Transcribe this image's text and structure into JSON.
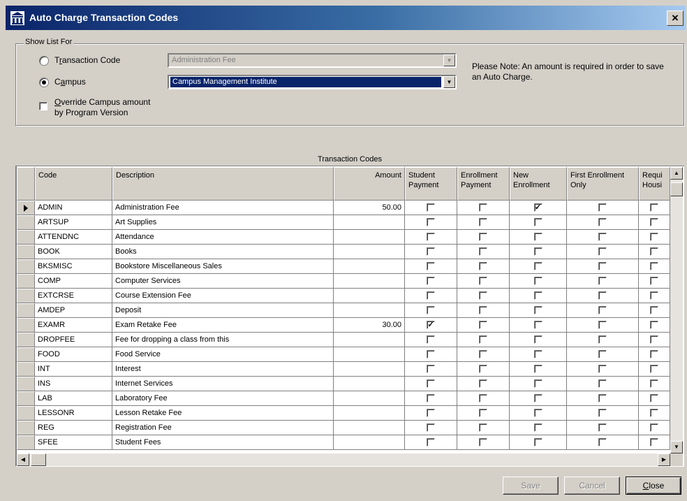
{
  "window": {
    "title": "Auto Charge Transaction Codes",
    "close_glyph": "×"
  },
  "filter": {
    "legend": "Show List For",
    "transaction_code": {
      "label": "Transaction Code",
      "accel": "r",
      "selected": false,
      "value": "Administration Fee"
    },
    "campus": {
      "label": "Campus",
      "accel": "a",
      "selected": true,
      "value": "Campus Management Institute"
    },
    "override": {
      "label_line1": "Override Campus amount",
      "label_line2": "by Program Version",
      "accel": "O",
      "checked": false
    },
    "note": "Please Note: An amount is required in order to save an Auto Charge."
  },
  "grid": {
    "caption": "Transaction Codes",
    "columns": [
      {
        "key": "code",
        "label": "Code"
      },
      {
        "key": "description",
        "label": "Description"
      },
      {
        "key": "amount",
        "label": "Amount"
      },
      {
        "key": "student_payment",
        "label": "Student Payment"
      },
      {
        "key": "enrollment_payment",
        "label": "Enrollment Payment"
      },
      {
        "key": "new_enrollment",
        "label": "New Enrollment"
      },
      {
        "key": "first_enrollment_only",
        "label": "First Enrollment Only"
      },
      {
        "key": "requires_housing",
        "label": "Requi Housi"
      }
    ],
    "rows": [
      {
        "code": "ADMIN",
        "description": "Administration Fee",
        "amount": "50.00",
        "checks": [
          false,
          false,
          true,
          false,
          false
        ],
        "current": true
      },
      {
        "code": "ARTSUP",
        "description": "Art Supplies",
        "amount": "",
        "checks": [
          false,
          false,
          false,
          false,
          false
        ]
      },
      {
        "code": "ATTENDNC",
        "description": "Attendance",
        "amount": "",
        "checks": [
          false,
          false,
          false,
          false,
          false
        ]
      },
      {
        "code": "BOOK",
        "description": "Books",
        "amount": "",
        "checks": [
          false,
          false,
          false,
          false,
          false
        ]
      },
      {
        "code": "BKSMISC",
        "description": "Bookstore Miscellaneous Sales",
        "amount": "",
        "checks": [
          false,
          false,
          false,
          false,
          false
        ]
      },
      {
        "code": "COMP",
        "description": "Computer Services",
        "amount": "",
        "checks": [
          false,
          false,
          false,
          false,
          false
        ]
      },
      {
        "code": "EXTCRSE",
        "description": "Course Extension Fee",
        "amount": "",
        "checks": [
          false,
          false,
          false,
          false,
          false
        ]
      },
      {
        "code": "AMDEP",
        "description": "Deposit",
        "amount": "",
        "checks": [
          false,
          false,
          false,
          false,
          false
        ]
      },
      {
        "code": "EXAMR",
        "description": "Exam Retake Fee",
        "amount": "30.00",
        "checks": [
          true,
          false,
          false,
          false,
          false
        ]
      },
      {
        "code": "DROPFEE",
        "description": "Fee for dropping a class from this",
        "amount": "",
        "checks": [
          false,
          false,
          false,
          false,
          false
        ]
      },
      {
        "code": "FOOD",
        "description": "Food Service",
        "amount": "",
        "checks": [
          false,
          false,
          false,
          false,
          false
        ]
      },
      {
        "code": "INT",
        "description": "Interest",
        "amount": "",
        "checks": [
          false,
          false,
          false,
          false,
          false
        ]
      },
      {
        "code": "INS",
        "description": "Internet Services",
        "amount": "",
        "checks": [
          false,
          false,
          false,
          false,
          false
        ]
      },
      {
        "code": "LAB",
        "description": "Laboratory Fee",
        "amount": "",
        "checks": [
          false,
          false,
          false,
          false,
          false
        ]
      },
      {
        "code": "LESSONR",
        "description": "Lesson Retake Fee",
        "amount": "",
        "checks": [
          false,
          false,
          false,
          false,
          false
        ]
      },
      {
        "code": "REG",
        "description": "Registration Fee",
        "amount": "",
        "checks": [
          false,
          false,
          false,
          false,
          false
        ]
      },
      {
        "code": "SFEE",
        "description": "Student Fees",
        "amount": "",
        "checks": [
          false,
          false,
          false,
          false,
          false
        ]
      }
    ]
  },
  "buttons": {
    "save": "Save",
    "cancel": "Cancel",
    "close": "Close"
  }
}
